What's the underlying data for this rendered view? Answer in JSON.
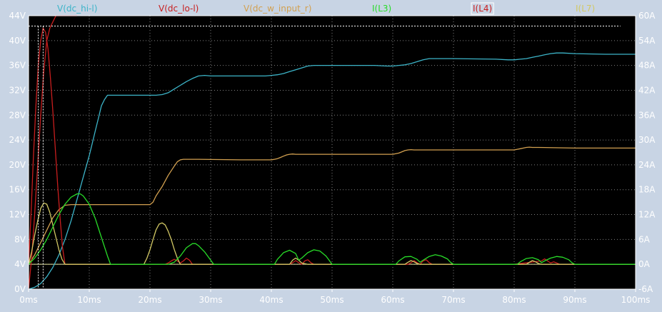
{
  "chart_data": {
    "type": "line",
    "background": "#000000",
    "frame_color": "#c8d4e4",
    "grid_color": "#808080",
    "grid": true,
    "xlim_ms": [
      0,
      100
    ],
    "ylim_left_V": [
      0,
      44
    ],
    "ylim_right_A": [
      -6,
      60
    ],
    "x_tick_labels": [
      "0ms",
      "10ms",
      "20ms",
      "30ms",
      "40ms",
      "50ms",
      "60ms",
      "70ms",
      "80ms",
      "90ms",
      "100ms"
    ],
    "y_left_tick_labels": [
      "0V",
      "4V",
      "8V",
      "12V",
      "16V",
      "20V",
      "24V",
      "28V",
      "32V",
      "36V",
      "40V",
      "44V"
    ],
    "y_right_tick_labels": [
      "-6A",
      "0A",
      "6A",
      "12A",
      "18A",
      "24A",
      "30A",
      "36A",
      "42A",
      "48A",
      "54A",
      "60A"
    ],
    "legend": [
      {
        "label": "V(dc_hi-l)",
        "color": "#3cb4c8"
      },
      {
        "label": "V(dc_lo-l)",
        "color": "#c81e1e"
      },
      {
        "label": "V(dc_w_input_r)",
        "color": "#d2a050"
      },
      {
        "label": "I(L3)",
        "color": "#28dc28"
      },
      {
        "label": "I(L4)",
        "color": "#c81e1e",
        "boxed": true
      },
      {
        "label": "I(L7)",
        "color": "#d2c864"
      }
    ],
    "series": [
      {
        "name": "V(dc_hi-l)",
        "color": "#3cb4c8",
        "axis": "left",
        "x": [
          0,
          1,
          2,
          3,
          4,
          5,
          6,
          7,
          8,
          9,
          10,
          10.5,
          11,
          11.5,
          12,
          12.5,
          13,
          14,
          16,
          19,
          20,
          21,
          22,
          23,
          24,
          25,
          26,
          27,
          28,
          29,
          30,
          33,
          39,
          40,
          41,
          42,
          43,
          44,
          45,
          46,
          47,
          48,
          50,
          57,
          59,
          60,
          61,
          62,
          63,
          64,
          65,
          66,
          67,
          68,
          70,
          77,
          79,
          80,
          81,
          82,
          83,
          84,
          85,
          86,
          87,
          88,
          90,
          95,
          100
        ],
        "y": [
          0,
          0.3,
          0.9,
          2,
          3.5,
          5.5,
          8,
          11,
          14.5,
          18,
          21.5,
          23.5,
          25.5,
          27.5,
          29.5,
          30.5,
          31.2,
          31.2,
          31.2,
          31.2,
          31.2,
          31.2,
          31.3,
          31.6,
          32.2,
          32.8,
          33.4,
          33.9,
          34.3,
          34.4,
          34.3,
          34.3,
          34.3,
          34.4,
          34.5,
          34.7,
          35,
          35.3,
          35.6,
          35.9,
          36,
          36,
          36,
          36,
          35.9,
          35.9,
          36,
          36.1,
          36.3,
          36.6,
          36.9,
          37.1,
          37.1,
          37.1,
          37.1,
          37.0,
          36.9,
          36.9,
          37,
          37.1,
          37.3,
          37.5,
          37.7,
          37.9,
          38,
          38,
          37.9,
          37.8,
          37.8
        ]
      },
      {
        "name": "V(dc_w_input_r)",
        "color": "#d2a050",
        "axis": "left",
        "x": [
          0,
          1,
          2,
          3,
          4,
          5,
          6,
          7,
          8,
          9,
          10,
          12,
          14,
          16,
          19,
          20,
          20.5,
          21,
          22,
          23,
          24,
          24.5,
          25,
          25.5,
          26,
          28,
          35,
          39,
          40,
          40.5,
          41,
          41.5,
          42,
          42.5,
          43,
          43.5,
          44,
          50,
          59,
          60,
          60.5,
          61,
          61.5,
          62,
          62.5,
          63,
          63.5,
          64,
          70,
          79,
          80,
          80.5,
          81,
          81.5,
          82,
          82.5,
          83,
          83.5,
          84,
          90,
          95,
          100
        ],
        "y": [
          4,
          5.5,
          7.5,
          9.5,
          11.5,
          12.8,
          13.5,
          13.6,
          13.6,
          13.6,
          13.6,
          13.6,
          13.6,
          13.6,
          13.6,
          13.6,
          14,
          15,
          16.5,
          18.3,
          19.8,
          20.5,
          20.8,
          20.9,
          20.9,
          20.9,
          20.8,
          20.8,
          20.8,
          20.9,
          21,
          21.2,
          21.4,
          21.6,
          21.7,
          21.75,
          21.7,
          21.7,
          21.7,
          21.7,
          21.8,
          21.9,
          22.1,
          22.3,
          22.4,
          22.45,
          22.4,
          22.4,
          22.4,
          22.4,
          22.4,
          22.5,
          22.6,
          22.7,
          22.8,
          22.85,
          22.8,
          22.8,
          22.8,
          22.7,
          22.7,
          22.7
        ]
      },
      {
        "name": "V(dc_lo-l)",
        "color": "#c81e1e",
        "axis": "left",
        "x": [
          0,
          0.5,
          1,
          1.5,
          2,
          2.5,
          3,
          3.5,
          4,
          4.5,
          5,
          6,
          7,
          8
        ],
        "y": [
          0,
          5,
          12,
          20,
          28,
          35,
          40,
          42,
          43,
          44,
          44.5,
          45,
          45.5,
          46
        ]
      },
      {
        "name": "I(L4)",
        "color": "#c81e1e",
        "axis": "right",
        "x": [
          0,
          0.4,
          0.8,
          1.2,
          1.6,
          2,
          2.4,
          2.8,
          3.2,
          3.6,
          4,
          4.4,
          4.8,
          5.2,
          5.6,
          6,
          6.4,
          7,
          10,
          20,
          22.5,
          23,
          23.5,
          24,
          24.5,
          25,
          25.5,
          26,
          26.5,
          27,
          30,
          40,
          43,
          43.5,
          44,
          44.5,
          45,
          45.5,
          46,
          46.5,
          47,
          50,
          60,
          62.5,
          63,
          63.5,
          64,
          64.5,
          65,
          65.5,
          66,
          66.5,
          67,
          70,
          80,
          84.5,
          85,
          85.5,
          86,
          86.5,
          87,
          87.5,
          88,
          90,
          95,
          100
        ],
        "y": [
          0,
          12,
          26,
          38,
          48,
          54,
          57,
          56,
          52,
          45,
          37,
          28,
          19,
          11,
          4,
          0,
          0,
          0,
          0,
          0,
          0,
          0.3,
          0.8,
          1.2,
          0.8,
          0.3,
          0.8,
          1.5,
          1,
          0,
          0,
          0,
          0,
          0.4,
          0.9,
          0.4,
          0,
          0.8,
          1.1,
          0.4,
          0,
          0,
          0,
          0,
          0.4,
          0.9,
          0.4,
          0,
          0.8,
          1.1,
          0.4,
          0,
          0,
          0,
          0,
          0.8,
          1.3,
          0.8,
          0.3,
          0.6,
          0.3,
          0,
          0,
          0,
          0,
          0
        ]
      },
      {
        "name": "I(L7)",
        "color": "#d2c864",
        "axis": "right",
        "x": [
          0,
          0.5,
          1,
          1.5,
          2,
          2.5,
          3,
          3.5,
          4,
          4.5,
          5,
          5.5,
          6,
          7,
          15,
          19,
          19.5,
          20,
          20.5,
          21,
          21.5,
          22,
          22.5,
          23,
          23.5,
          24,
          24.5,
          25,
          30,
          40,
          41,
          42,
          43,
          43.5,
          44,
          44.5,
          45,
          46,
          50,
          60,
          61,
          62,
          62.5,
          63,
          63.5,
          64,
          64.5,
          65,
          70,
          80,
          81,
          82,
          82.5,
          83,
          83.5,
          84,
          84.5,
          85,
          90,
          95,
          100
        ],
        "y": [
          0,
          3,
          7,
          10.5,
          13.5,
          14.8,
          14.5,
          12.5,
          9.5,
          6.5,
          3.5,
          1.2,
          0,
          0,
          0,
          0,
          1.5,
          3.5,
          6,
          8.3,
          9.7,
          10,
          9.5,
          8,
          6,
          3.6,
          1.5,
          0,
          0,
          0,
          0,
          0,
          0,
          1,
          1.5,
          1,
          0.3,
          0,
          0,
          0,
          0,
          0,
          0.5,
          0.9,
          0.6,
          0.2,
          0,
          0,
          0,
          0,
          0,
          0,
          0.5,
          0.9,
          0.6,
          0.2,
          0,
          0,
          0,
          0,
          0
        ]
      },
      {
        "name": "I(L3)",
        "color": "#28dc28",
        "axis": "right",
        "x": [
          0,
          1,
          2,
          3,
          4,
          5,
          6,
          7,
          8,
          8.5,
          9,
          10,
          11,
          12,
          13,
          13.5,
          14,
          20,
          22,
          23,
          24,
          25,
          25.5,
          26,
          27,
          27.5,
          28,
          29,
          30,
          30.5,
          31,
          40,
          40.5,
          41,
          42,
          43,
          44,
          44.5,
          45,
          46,
          47,
          48,
          49,
          49.5,
          50,
          60,
          60.5,
          61,
          62,
          63,
          64,
          64.5,
          65,
          66,
          67,
          68,
          69,
          69.5,
          70,
          80,
          80.5,
          81,
          82,
          83,
          84,
          84.5,
          85,
          86,
          87,
          88,
          89,
          89.5,
          90,
          95,
          100
        ],
        "y": [
          0,
          1.5,
          3.5,
          6,
          9,
          12,
          14.5,
          16.2,
          17,
          17,
          16.5,
          14.5,
          11,
          6.5,
          2,
          0,
          0,
          0,
          0,
          0,
          0.5,
          2,
          3,
          4,
          5,
          5,
          4.5,
          3,
          1,
          0,
          0,
          0,
          0,
          1.2,
          2.8,
          3.4,
          2.6,
          1,
          1.5,
          2.8,
          3.5,
          3.2,
          2,
          1,
          0,
          0,
          0,
          0.8,
          1.8,
          1.9,
          1.2,
          0.5,
          1,
          1.9,
          2.3,
          2,
          1.3,
          0.5,
          0,
          0,
          0,
          0.6,
          1.4,
          1.6,
          1.1,
          0.4,
          0.8,
          1.5,
          1.9,
          1.7,
          1.1,
          0.4,
          0,
          0,
          0
        ]
      }
    ],
    "markers": {
      "color": "#ffffff",
      "vertical_ms": [
        1.6,
        2.4
      ],
      "horizontal_A": [
        57.5
      ]
    }
  }
}
